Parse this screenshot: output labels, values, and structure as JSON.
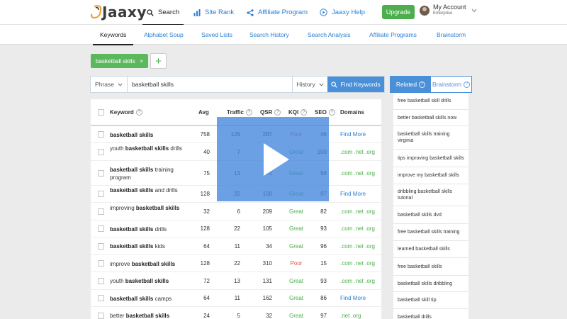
{
  "app": {
    "logo_text": "Jaaxy"
  },
  "nav": {
    "search": "Search",
    "site_rank": "Site Rank",
    "affiliate_program": "Affiliate Program",
    "jaaxy_help": "Jaaxy Help",
    "upgrade": "Upgrade",
    "account_name": "My Account",
    "account_plan": "Enterprise"
  },
  "tabs": [
    "Keywords",
    "Alphabet Soup",
    "Saved Lists",
    "Search History",
    "Search Analysis",
    "Affiliate Programs",
    "Brainstorm"
  ],
  "chip": {
    "label": "basketball skills",
    "close": "×",
    "add": "+"
  },
  "search": {
    "mode": "Phrase",
    "value": "basketball skills",
    "history": "History",
    "button": "Find Keywords"
  },
  "side_tabs": {
    "related": "Related",
    "brainstorm": "Brainstorm"
  },
  "table": {
    "headers": {
      "keyword": "Keyword",
      "avg": "Avg",
      "traffic": "Traffic",
      "qsr": "QSR",
      "kqi": "KQI",
      "seo": "SEO",
      "domains": "Domains"
    },
    "rows": [
      {
        "pre": "",
        "bold": "basketball skills",
        "post": "",
        "avg": "758",
        "traffic": "129",
        "qsr": "287",
        "kqi": "Poor",
        "seo": "46",
        "domains": "Find More"
      },
      {
        "pre": "youth ",
        "bold": "basketball skills",
        "post": " drills",
        "avg": "40",
        "traffic": "7",
        "qsr": "14",
        "kqi": "Great",
        "seo": "100",
        "domains": ".com .net .org"
      },
      {
        "pre": "",
        "bold": "basketball skills",
        "post": " training program",
        "avg": "75",
        "traffic": "13",
        "qsr": "70",
        "kqi": "Great",
        "seo": "98",
        "domains": ".com .net .org"
      },
      {
        "pre": "",
        "bold": "basketball skills",
        "post": " and drills",
        "avg": "128",
        "traffic": "22",
        "qsr": "100",
        "kqi": "Great",
        "seo": "97",
        "domains": "Find More"
      },
      {
        "pre": "improving ",
        "bold": "basketball skills",
        "post": "",
        "avg": "32",
        "traffic": "6",
        "qsr": "209",
        "kqi": "Great",
        "seo": "82",
        "domains": ".com .net .org"
      },
      {
        "pre": "",
        "bold": "basketball skills",
        "post": " drills",
        "avg": "128",
        "traffic": "22",
        "qsr": "105",
        "kqi": "Great",
        "seo": "93",
        "domains": ".com .net .org"
      },
      {
        "pre": "",
        "bold": "basketball skills",
        "post": " kids",
        "avg": "64",
        "traffic": "11",
        "qsr": "34",
        "kqi": "Great",
        "seo": "96",
        "domains": ".com .net .org"
      },
      {
        "pre": "improve ",
        "bold": "basketball skills",
        "post": "",
        "avg": "128",
        "traffic": "22",
        "qsr": "310",
        "kqi": "Poor",
        "seo": "15",
        "domains": ".com .net .org"
      },
      {
        "pre": "youth ",
        "bold": "basketball skills",
        "post": "",
        "avg": "72",
        "traffic": "13",
        "qsr": "131",
        "kqi": "Great",
        "seo": "93",
        "domains": ".com .net .org"
      },
      {
        "pre": "",
        "bold": "basketball skills",
        "post": " camps",
        "avg": "64",
        "traffic": "11",
        "qsr": "162",
        "kqi": "Great",
        "seo": "86",
        "domains": "Find More"
      },
      {
        "pre": "better ",
        "bold": "basketball skills",
        "post": "",
        "avg": "24",
        "traffic": "5",
        "qsr": "32",
        "kqi": "Great",
        "seo": "97",
        "domains": ".net .org"
      }
    ]
  },
  "related": [
    "free basketball skill drills",
    "better basketball skills now",
    "basketball skills training virginia",
    "tips improving basketball skills",
    "improve my basketball skills",
    "dribbling basketball skills tutorial",
    "basketball skills dvd",
    "free basketball skills training",
    "learned basketball skills",
    "free basketball skills",
    "basketball skills dribbling",
    "basketball skill tip",
    "basketball drills"
  ],
  "colors": {
    "accent": "#2a7fd4",
    "green": "#4cae4c",
    "red": "#d9534f",
    "overlay": "#4285de"
  },
  "icons": [
    "search-icon",
    "bar-chart-icon",
    "share-icon",
    "play-circle-icon",
    "chevron-down-icon",
    "help-icon",
    "play-icon"
  ]
}
